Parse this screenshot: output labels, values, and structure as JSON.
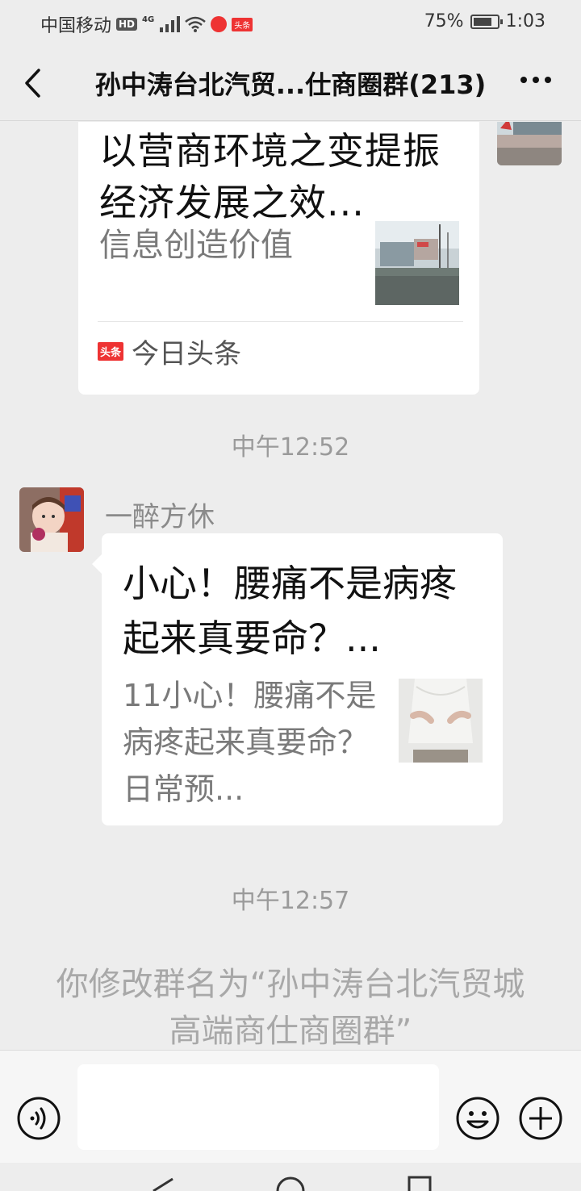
{
  "status_bar": {
    "carrier": "中国移动",
    "hd": "HD",
    "network": "4G",
    "toutiao": "头条",
    "battery_percent": "75%",
    "time": "1:03"
  },
  "header": {
    "title": "孙中涛台北汽贸...仕商圈群(213)",
    "back_icon": "back-arrow-icon",
    "more_icon": "more-dots-icon"
  },
  "messages": [
    {
      "type": "link-card",
      "title": "以营商环境之变提振经济发展之效...",
      "description": "信息创造价值",
      "source_badge": "头条",
      "source": "今日头条"
    },
    {
      "type": "time",
      "text": "中午12:52"
    },
    {
      "type": "link-card",
      "sender": "一醉方休",
      "title": "小心！腰痛不是病疼起来真要命？...",
      "description": "11小心！腰痛不是病疼起来真要命？日常预..."
    },
    {
      "type": "time",
      "text": "中午12:57"
    },
    {
      "type": "system",
      "text": "你修改群名为“孙中涛台北汽贸城高端商仕商圈群”"
    }
  ],
  "input_bar": {
    "message_value": "",
    "icons": [
      "voice-icon",
      "emoji-icon",
      "add-icon"
    ]
  },
  "colors": {
    "background": "#ededed",
    "card": "#ffffff",
    "muted_text": "#9a9a9a",
    "toutiao_red": "#e33333"
  }
}
